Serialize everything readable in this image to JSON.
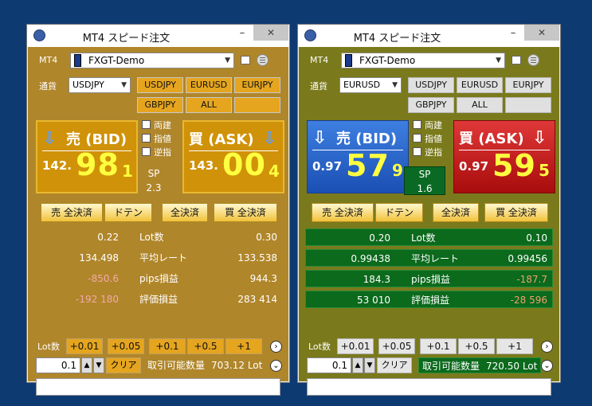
{
  "windows": [
    {
      "title": "MT4 スピード注文",
      "min_label": "–",
      "close_label": "✕",
      "platform_label": "MT4",
      "account": "FXGT-Demo",
      "symbol_label": "通貨",
      "symbol": "USDJPY",
      "symbol_buttons": [
        "USDJPY",
        "EURUSD",
        "EURJPY",
        "GBPJPY",
        "ALL",
        ""
      ],
      "bid_label": "売 (BID)",
      "ask_label": "買 (ASK)",
      "bid_prefix": "142.",
      "bid_big": "98",
      "bid_sup": "1",
      "ask_prefix": "143.",
      "ask_big": "00",
      "ask_sup": "4",
      "options": [
        "両建",
        "指値",
        "逆指"
      ],
      "sp_label": "SP",
      "sp_value": "2.3",
      "actions": [
        "売 全決済",
        "ドテン",
        "全決済",
        "買 全決済"
      ],
      "stats": [
        {
          "left": "0.22",
          "label": "Lot数",
          "right": "0.30"
        },
        {
          "left": "134.498",
          "label": "平均レート",
          "right": "133.538"
        },
        {
          "left": "-850.6",
          "label": "pips損益",
          "right": "944.3"
        },
        {
          "left": "-192 180",
          "label": "評価損益",
          "right": "283 414"
        }
      ],
      "lot_label": "Lot数",
      "lot_buttons": [
        "+0.01",
        "+0.05",
        "+0.1",
        "+0.5",
        "+1"
      ],
      "lot_value": "0.1",
      "clear_label": "クリア",
      "available_label": "取引可能数量",
      "available_value": "703.12 Lot"
    },
    {
      "title": "MT4 スピード注文",
      "min_label": "–",
      "close_label": "✕",
      "platform_label": "MT4",
      "account": "FXGT-Demo",
      "symbol_label": "通貨",
      "symbol": "EURUSD",
      "symbol_buttons": [
        "USDJPY",
        "EURUSD",
        "EURJPY",
        "GBPJPY",
        "ALL",
        ""
      ],
      "bid_label": "売 (BID)",
      "ask_label": "買 (ASK)",
      "bid_prefix": "0.97",
      "bid_big": "57",
      "bid_sup": "9",
      "ask_prefix": "0.97",
      "ask_big": "59",
      "ask_sup": "5",
      "options": [
        "両建",
        "指値",
        "逆指"
      ],
      "sp_label": "SP",
      "sp_value": "1.6",
      "actions": [
        "売 全決済",
        "ドテン",
        "全決済",
        "買 全決済"
      ],
      "stats": [
        {
          "left": "0.20",
          "label": "Lot数",
          "right": "0.10"
        },
        {
          "left": "0.99438",
          "label": "平均レート",
          "right": "0.99456"
        },
        {
          "left": "184.3",
          "label": "pips損益",
          "right": "-187.7"
        },
        {
          "left": "53 010",
          "label": "評価損益",
          "right": "-28 596"
        }
      ],
      "lot_label": "Lot数",
      "lot_buttons": [
        "+0.01",
        "+0.05",
        "+0.1",
        "+0.5",
        "+1"
      ],
      "lot_value": "0.1",
      "clear_label": "クリア",
      "available_label": "取引可能数量",
      "available_value": "720.50 Lot"
    }
  ],
  "colors": {
    "desktop": "#0e3a72",
    "w1_panel": "#b0862a",
    "w2_panel": "#7a7a1c",
    "price_digits": "#ffff40"
  }
}
